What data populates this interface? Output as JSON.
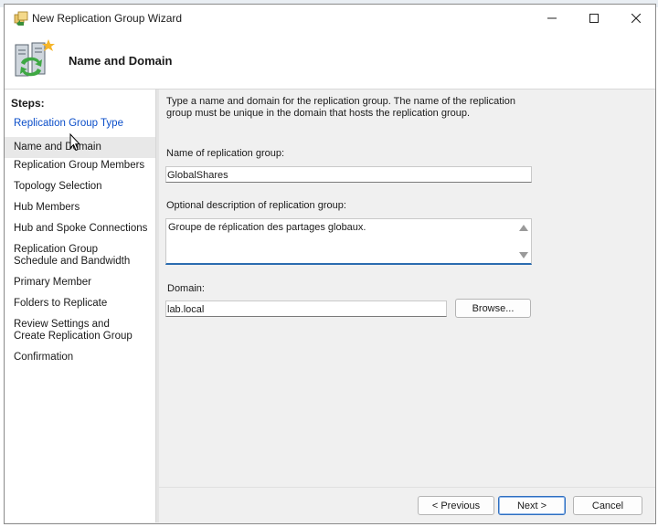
{
  "window": {
    "title": "New Replication Group Wizard"
  },
  "header": {
    "title": "Name and Domain"
  },
  "steps": {
    "heading": "Steps:",
    "items": [
      {
        "label": "Replication Group Type",
        "state": "link"
      },
      {
        "label": "Name and Domain",
        "state": "current"
      },
      {
        "label": "Replication Group Members",
        "state": "normal"
      },
      {
        "label": "Topology Selection",
        "state": "normal"
      },
      {
        "label": "Hub Members",
        "state": "normal"
      },
      {
        "label": "Hub and Spoke Connections",
        "state": "normal"
      },
      {
        "label": "Replication Group Schedule and Bandwidth",
        "state": "normal"
      },
      {
        "label": "Primary Member",
        "state": "normal"
      },
      {
        "label": "Folders to Replicate",
        "state": "normal"
      },
      {
        "label": "Review Settings and Create Replication Group",
        "state": "normal"
      },
      {
        "label": "Confirmation",
        "state": "normal"
      }
    ]
  },
  "form": {
    "intro": "Type a name and domain for the replication group. The name of the replication group must be unique in the domain that hosts the replication group.",
    "name_label": "Name of replication group:",
    "name_value": "GlobalShares",
    "description_label": "Optional description of replication group:",
    "description_value": "Groupe de réplication des partages globaux.",
    "domain_label": "Domain:",
    "domain_value": "lab.local",
    "browse_label": "Browse..."
  },
  "buttons": {
    "previous": "< Previous",
    "next": "Next >",
    "cancel": "Cancel"
  },
  "colors": {
    "link": "#0b4ec9",
    "focus_border": "#2b6cb0",
    "window_bg": "#f0f0f0"
  },
  "icons": {
    "app": "replication-group-icon",
    "header": "replication-server-icon",
    "minimize": "minimize-icon",
    "maximize": "maximize-icon",
    "close": "close-icon",
    "cursor": "mouse-pointer-icon"
  }
}
